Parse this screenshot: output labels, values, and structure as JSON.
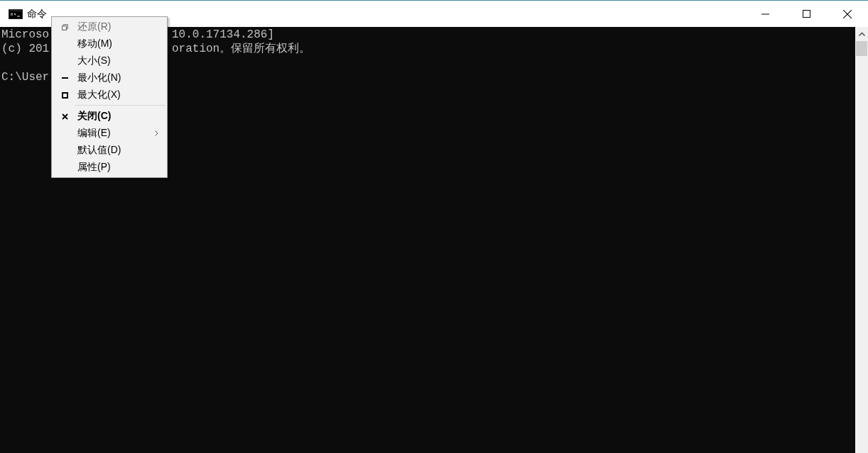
{
  "window": {
    "title": "命令"
  },
  "console": {
    "lines": [
      {
        "kind": "text",
        "left": "Microso",
        "right": "10.0.17134.286]"
      },
      {
        "kind": "text",
        "left": "(c) 201",
        "right": "oration。保留所有权利。"
      },
      {
        "kind": "blank"
      },
      {
        "kind": "text",
        "left": "C:\\User"
      }
    ]
  },
  "system_menu": {
    "items": [
      {
        "kind": "restore",
        "label": "还原(R)",
        "disabled": true,
        "default": false
      },
      {
        "kind": "plain",
        "label": "移动(M)",
        "disabled": false,
        "default": false
      },
      {
        "kind": "plain",
        "label": "大小(S)",
        "disabled": false,
        "default": false
      },
      {
        "kind": "minimize",
        "label": "最小化(N)",
        "disabled": false,
        "default": false
      },
      {
        "kind": "maximize",
        "label": "最大化(X)",
        "disabled": false,
        "default": false
      },
      {
        "kind": "separator"
      },
      {
        "kind": "close",
        "label": "关闭(C)",
        "disabled": false,
        "default": true
      },
      {
        "kind": "submenu",
        "label": "编辑(E)",
        "disabled": false,
        "default": false
      },
      {
        "kind": "plain",
        "label": "默认值(D)",
        "disabled": false,
        "default": false
      },
      {
        "kind": "plain",
        "label": "属性(P)",
        "disabled": false,
        "default": false
      }
    ]
  }
}
